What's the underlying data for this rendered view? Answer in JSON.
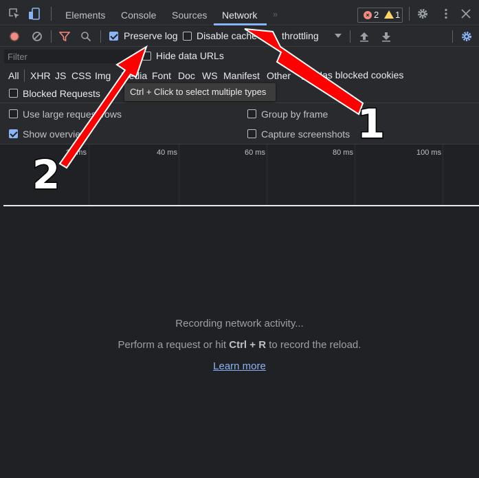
{
  "tabs": [
    {
      "label": "Elements"
    },
    {
      "label": "Console"
    },
    {
      "label": "Sources"
    },
    {
      "label": "Network"
    }
  ],
  "issues": {
    "errors": "2",
    "warnings": "1"
  },
  "toolbar": {
    "preserve_log": "Preserve log",
    "disable_cache": "Disable cache",
    "throttling": "throttling"
  },
  "filter": {
    "placeholder": "Filter",
    "hide_data_urls": "Hide data URLs",
    "types": [
      "All",
      "XHR",
      "JS",
      "CSS",
      "Img",
      "Media",
      "Font",
      "Doc",
      "WS",
      "Manifest",
      "Other"
    ],
    "has_blocked_cookies": "Has blocked cookies",
    "blocked_requests": "Blocked Requests",
    "tooltip": "Ctrl + Click to select multiple types"
  },
  "settings": {
    "large_rows": "Use large request rows",
    "show_overview": "Show overview",
    "group_by_frame": "Group by frame",
    "capture_screenshots": "Capture screenshots"
  },
  "overview": {
    "ticks": [
      "20 ms",
      "40 ms",
      "60 ms",
      "80 ms",
      "100 ms"
    ]
  },
  "empty_state": {
    "line1": "Recording network activity...",
    "line2_prefix": "Perform a request or hit ",
    "line2_keys": "Ctrl + R",
    "line2_suffix": " to record the reload.",
    "learn_more": "Learn more"
  },
  "annotations": {
    "arrow1": "1",
    "arrow2": "2"
  },
  "colors": {
    "accent": "#8ab4f8",
    "arrow": "#ff0000",
    "record": "#f28b82"
  }
}
